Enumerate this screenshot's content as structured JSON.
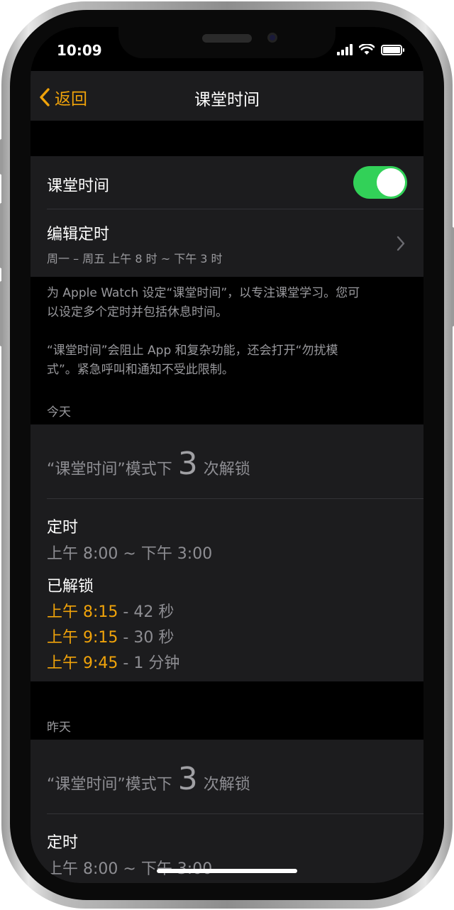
{
  "status_bar": {
    "time": "10:09"
  },
  "nav": {
    "back_label": "返回",
    "title": "课堂时间"
  },
  "settings": {
    "toggle_label": "课堂时间",
    "toggle_on": true,
    "schedule_label": "编辑定时",
    "schedule_detail": "周一 – 周五 上午 8 时 ~ 下午 3 时"
  },
  "description": {
    "para1_line1": "为 Apple Watch 设定“课堂时间”，以专注课堂学习。您可",
    "para1_line2": "以设定多个定时并包括休息时间。",
    "para2_line1": "“课堂时间”会阻止 App 和复杂功能，还会打开“勿扰模",
    "para2_line2": "式”。紧急呼叫和通知不受此限制。"
  },
  "today": {
    "header": "今天",
    "unlock_prefix": "“课堂时间”模式下",
    "unlock_count": "3",
    "unlock_suffix": "次解锁",
    "schedule_label": "定时",
    "schedule_value": "上午 8:00 ~ 下午 3:00",
    "unlocked_label": "已解锁",
    "entries": [
      {
        "time": "上午 8:15",
        "duration": " - 42 秒"
      },
      {
        "time": "上午 9:15",
        "duration": " - 30 秒"
      },
      {
        "time": "上午 9:45",
        "duration": " - 1 分钟"
      }
    ]
  },
  "yesterday": {
    "header": "昨天",
    "unlock_prefix": "“课堂时间”模式下",
    "unlock_count": "3",
    "unlock_suffix": "次解锁",
    "schedule_label": "定时",
    "schedule_value": "上午 8:00 ~ 下午 3:00"
  },
  "colors": {
    "accent": "#f0a30a",
    "toggle_on": "#32d158",
    "cell_bg": "#1c1c1e"
  },
  "icons": [
    "chevron-left-icon",
    "chevron-right-icon",
    "cellular-signal-icon",
    "wifi-icon",
    "battery-icon"
  ]
}
